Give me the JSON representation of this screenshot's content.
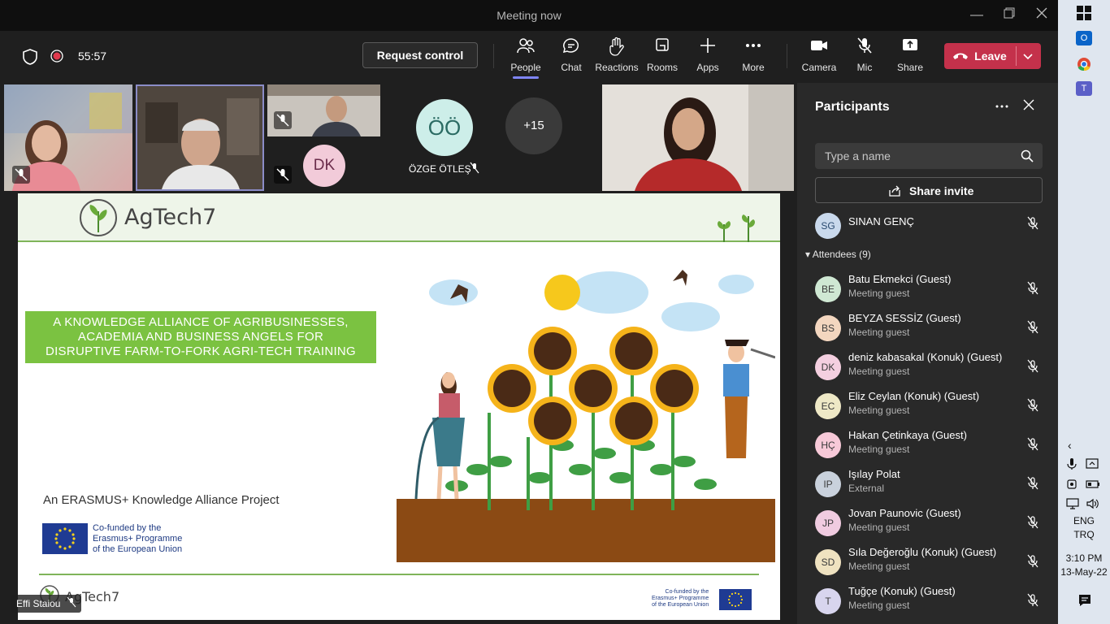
{
  "window": {
    "title": "Meeting now"
  },
  "toolbar": {
    "timer": "55:57",
    "request_control": "Request control",
    "buttons": {
      "people": "People",
      "chat": "Chat",
      "reactions": "Reactions",
      "rooms": "Rooms",
      "apps": "Apps",
      "more": "More",
      "camera": "Camera",
      "mic": "Mic",
      "share": "Share"
    },
    "leave": "Leave"
  },
  "video": {
    "tile_initials": {
      "dk": "DK",
      "oo": "ÖÖ"
    },
    "oo_name": "ÖZGE ÖTLEŞ",
    "overflow_count": "+15",
    "presenter_name": "Effi Staiou"
  },
  "slide": {
    "brand": "AgTech7",
    "banner_lines": [
      "A KNOWLEDGE ALLIANCE OF AGRIBUSINESSES,",
      "ACADEMIA AND BUSINESS ANGELS FOR",
      "DISRUPTIVE FARM-TO-FORK AGRI-TECH TRAINING"
    ],
    "project_line": "An ERASMUS+ Knowledge Alliance Project",
    "cofund_lines": [
      "Co-funded by the",
      "Erasmus+ Programme",
      "of the European Union"
    ],
    "footer_brand": "AgTech7"
  },
  "participants": {
    "title": "Participants",
    "search_placeholder": "Type a name",
    "share_invite": "Share invite",
    "top_person": {
      "initials": "SG",
      "name": "SINAN GENÇ"
    },
    "attendees_header": "Attendees (9)",
    "attendees": [
      {
        "initials": "BE",
        "name": "Batu Ekmekci (Guest)",
        "role": "Meeting guest",
        "color": "#cfe8d3"
      },
      {
        "initials": "BS",
        "name": "BEYZA SESSİZ (Guest)",
        "role": "Meeting guest",
        "color": "#f3d6bf"
      },
      {
        "initials": "DK",
        "name": "deniz kabasakal (Konuk) (Guest)",
        "role": "Meeting guest",
        "color": "#f4cfe0"
      },
      {
        "initials": "EC",
        "name": "Eliz Ceylan (Konuk) (Guest)",
        "role": "Meeting guest",
        "color": "#eee8c6"
      },
      {
        "initials": "HÇ",
        "name": "Hakan Çetinkaya (Guest)",
        "role": "Meeting guest",
        "color": "#f7c9d8"
      },
      {
        "initials": "IP",
        "name": "Işılay Polat",
        "role": "External",
        "color": "#c9d1dc"
      },
      {
        "initials": "JP",
        "name": "Jovan Paunovic (Guest)",
        "role": "Meeting guest",
        "color": "#f0cbe0"
      },
      {
        "initials": "SD",
        "name": "Sıla Değeroğlu (Konuk) (Guest)",
        "role": "Meeting guest",
        "color": "#efe2c0"
      },
      {
        "initials": "T",
        "name": "Tuğçe (Konuk) (Guest)",
        "role": "Meeting guest",
        "color": "#d8d5ee"
      }
    ]
  },
  "taskbar": {
    "lang1": "ENG",
    "lang2": "TRQ",
    "time": "3:10 PM",
    "date": "13-May-22"
  }
}
